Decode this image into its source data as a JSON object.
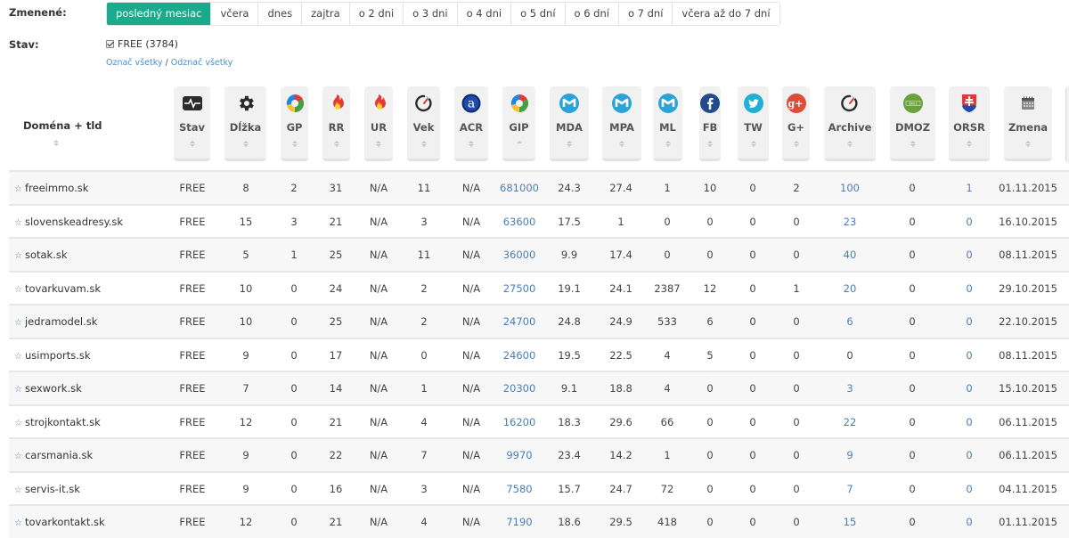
{
  "filters": {
    "changed_label": "Zmenené:",
    "periods": [
      "posledný mesiac",
      "včera",
      "dnes",
      "zajtra",
      "o 2 dni",
      "o 3 dni",
      "o 4 dni",
      "o 5 dní",
      "o 6 dní",
      "o 7 dní",
      "včera až do 7 dní"
    ],
    "active_period": "posledný mesiac",
    "status_label": "Stav:",
    "status_option": "FREE (3784)",
    "status_checked": true,
    "select_all": "Označ všetky",
    "separator": "/",
    "deselect_all": "Odznač všetky"
  },
  "table": {
    "domain_header": "Doména + tld",
    "columns": [
      {
        "key": "stav",
        "label": "Stav",
        "icon": "heartbeat-monitor-icon"
      },
      {
        "key": "dlzka",
        "label": "Dĺžka",
        "icon": "gear-icon"
      },
      {
        "key": "gp",
        "label": "GP",
        "icon": "google-icon"
      },
      {
        "key": "rr",
        "label": "RR",
        "icon": "fire-icon"
      },
      {
        "key": "ur",
        "label": "UR",
        "icon": "fire-icon"
      },
      {
        "key": "vek",
        "label": "Vek",
        "icon": "stopwatch-icon"
      },
      {
        "key": "acr",
        "label": "ACR",
        "icon": "alexa-icon"
      },
      {
        "key": "gip",
        "label": "GIP",
        "icon": "google-icon",
        "sorted": "asc"
      },
      {
        "key": "mda",
        "label": "MDA",
        "icon": "moz-icon"
      },
      {
        "key": "mpa",
        "label": "MPA",
        "icon": "moz-icon"
      },
      {
        "key": "ml",
        "label": "ML",
        "icon": "moz-icon"
      },
      {
        "key": "fb",
        "label": "FB",
        "icon": "facebook-icon"
      },
      {
        "key": "tw",
        "label": "TW",
        "icon": "twitter-icon"
      },
      {
        "key": "gplus",
        "label": "G+",
        "icon": "google-plus-icon"
      },
      {
        "key": "archive",
        "label": "Archive",
        "icon": "stopwatch-icon"
      },
      {
        "key": "dmoz",
        "label": "DMOZ",
        "icon": "dmoz-icon"
      },
      {
        "key": "orsr",
        "label": "ORSR",
        "icon": "slovak-coat-of-arms-icon"
      },
      {
        "key": "zmena",
        "label": "Zmena",
        "icon": "calendar-icon"
      }
    ],
    "rows": [
      {
        "domain": "freeimmo.sk",
        "stav": "FREE",
        "dlzka": "8",
        "gp": "2",
        "rr": "31",
        "ur": "N/A",
        "vek": "11",
        "acr": "N/A",
        "gip": "681000",
        "mda": "24.3",
        "mpa": "27.4",
        "ml": "1",
        "fb": "10",
        "tw": "0",
        "gplus": "2",
        "archive": "100",
        "dmoz": "0",
        "orsr": "1",
        "zmena": "01.11.2015"
      },
      {
        "domain": "slovenskeadresy.sk",
        "stav": "FREE",
        "dlzka": "15",
        "gp": "3",
        "rr": "21",
        "ur": "N/A",
        "vek": "3",
        "acr": "N/A",
        "gip": "63600",
        "mda": "17.5",
        "mpa": "1",
        "ml": "0",
        "fb": "0",
        "tw": "0",
        "gplus": "0",
        "archive": "23",
        "dmoz": "0",
        "orsr": "0",
        "zmena": "16.10.2015"
      },
      {
        "domain": "sotak.sk",
        "stav": "FREE",
        "dlzka": "5",
        "gp": "1",
        "rr": "25",
        "ur": "N/A",
        "vek": "11",
        "acr": "N/A",
        "gip": "36000",
        "mda": "9.9",
        "mpa": "17.4",
        "ml": "0",
        "fb": "0",
        "tw": "0",
        "gplus": "0",
        "archive": "40",
        "dmoz": "0",
        "orsr": "0",
        "zmena": "08.11.2015"
      },
      {
        "domain": "tovarkuvam.sk",
        "stav": "FREE",
        "dlzka": "10",
        "gp": "0",
        "rr": "24",
        "ur": "N/A",
        "vek": "2",
        "acr": "N/A",
        "gip": "27500",
        "mda": "19.1",
        "mpa": "24.1",
        "ml": "2387",
        "fb": "12",
        "tw": "0",
        "gplus": "1",
        "archive": "20",
        "dmoz": "0",
        "orsr": "0",
        "zmena": "29.10.2015"
      },
      {
        "domain": "jedramodel.sk",
        "stav": "FREE",
        "dlzka": "10",
        "gp": "0",
        "rr": "25",
        "ur": "N/A",
        "vek": "2",
        "acr": "N/A",
        "gip": "24700",
        "mda": "24.8",
        "mpa": "24.9",
        "ml": "533",
        "fb": "6",
        "tw": "0",
        "gplus": "0",
        "archive": "6",
        "dmoz": "0",
        "orsr": "0",
        "zmena": "22.10.2015"
      },
      {
        "domain": "usimports.sk",
        "stav": "FREE",
        "dlzka": "9",
        "gp": "0",
        "rr": "17",
        "ur": "N/A",
        "vek": "0",
        "acr": "N/A",
        "gip": "24600",
        "mda": "19.5",
        "mpa": "22.5",
        "ml": "4",
        "fb": "5",
        "tw": "0",
        "gplus": "0",
        "archive": "0",
        "dmoz": "0",
        "orsr": "0",
        "zmena": "08.11.2015"
      },
      {
        "domain": "sexwork.sk",
        "stav": "FREE",
        "dlzka": "7",
        "gp": "0",
        "rr": "14",
        "ur": "N/A",
        "vek": "1",
        "acr": "N/A",
        "gip": "20300",
        "mda": "9.1",
        "mpa": "18.8",
        "ml": "4",
        "fb": "0",
        "tw": "0",
        "gplus": "0",
        "archive": "3",
        "dmoz": "0",
        "orsr": "0",
        "zmena": "15.10.2015"
      },
      {
        "domain": "strojkontakt.sk",
        "stav": "FREE",
        "dlzka": "12",
        "gp": "0",
        "rr": "21",
        "ur": "N/A",
        "vek": "4",
        "acr": "N/A",
        "gip": "16200",
        "mda": "18.3",
        "mpa": "29.6",
        "ml": "66",
        "fb": "0",
        "tw": "0",
        "gplus": "0",
        "archive": "22",
        "dmoz": "0",
        "orsr": "0",
        "zmena": "06.11.2015"
      },
      {
        "domain": "carsmania.sk",
        "stav": "FREE",
        "dlzka": "9",
        "gp": "0",
        "rr": "22",
        "ur": "N/A",
        "vek": "7",
        "acr": "N/A",
        "gip": "9970",
        "mda": "23.4",
        "mpa": "14.2",
        "ml": "1",
        "fb": "0",
        "tw": "0",
        "gplus": "0",
        "archive": "9",
        "dmoz": "0",
        "orsr": "0",
        "zmena": "06.11.2015"
      },
      {
        "domain": "servis-it.sk",
        "stav": "FREE",
        "dlzka": "9",
        "gp": "0",
        "rr": "16",
        "ur": "N/A",
        "vek": "3",
        "acr": "N/A",
        "gip": "7580",
        "mda": "15.7",
        "mpa": "24.7",
        "ml": "72",
        "fb": "0",
        "tw": "0",
        "gplus": "0",
        "archive": "7",
        "dmoz": "0",
        "orsr": "0",
        "zmena": "04.11.2015"
      },
      {
        "domain": "tovarkontakt.sk",
        "stav": "FREE",
        "dlzka": "12",
        "gp": "0",
        "rr": "21",
        "ur": "N/A",
        "vek": "4",
        "acr": "N/A",
        "gip": "7190",
        "mda": "18.6",
        "mpa": "29.5",
        "ml": "418",
        "fb": "0",
        "tw": "0",
        "gplus": "0",
        "archive": "15",
        "dmoz": "0",
        "orsr": "0",
        "zmena": "01.11.2015"
      }
    ]
  },
  "colors": {
    "accent": "#1aab8a",
    "link": "#4a7fb5",
    "row_alt": "#f7f7f7",
    "header_bg": "#f1f1f1"
  }
}
